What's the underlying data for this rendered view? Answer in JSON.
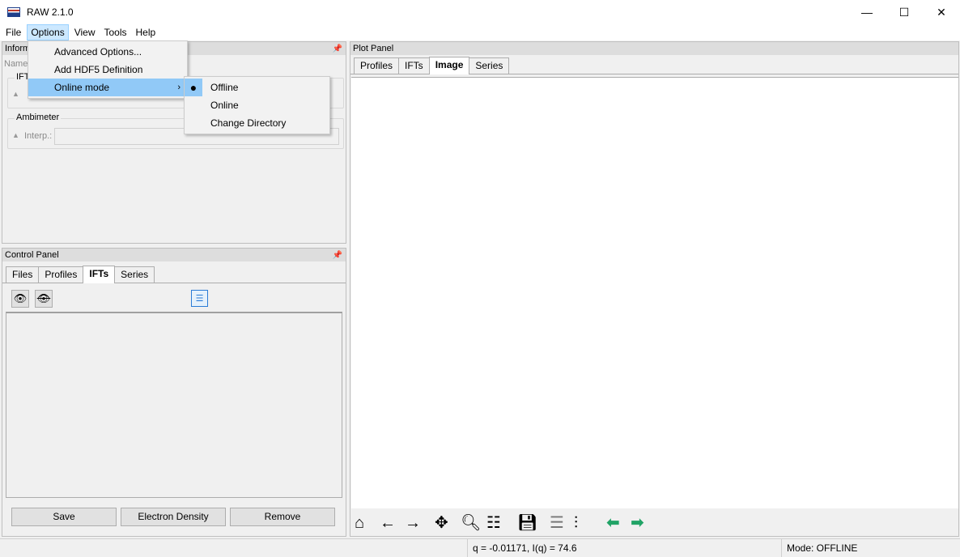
{
  "window": {
    "title": "RAW 2.1.0",
    "controls": [
      "—",
      "☐",
      "✕"
    ]
  },
  "menubar": {
    "file": "File",
    "options": "Options",
    "view": "View",
    "tools": "Tools",
    "help": "Help"
  },
  "options_menu": {
    "items": [
      "Advanced Options...",
      "Add HDF5 Definition",
      "Online mode"
    ],
    "submenu_arrow": "›"
  },
  "online_submenu": {
    "items": [
      "Offline",
      "Online",
      "Change Directory"
    ],
    "selected_marker": "●"
  },
  "info_panel": {
    "title": "Inform",
    "name_label": "Name:",
    "ift_group": "IFT",
    "ambimeter_group": "Ambimeter",
    "interp_label": "Interp.:"
  },
  "control_panel": {
    "title": "Control Panel",
    "tabs": [
      "Files",
      "Profiles",
      "IFTs",
      "Series"
    ],
    "active_tab": "IFTs",
    "buttons": {
      "save": "Save",
      "electron_density": "Electron Density",
      "remove": "Remove"
    }
  },
  "plot_panel": {
    "title": "Plot Panel",
    "tabs": [
      "Profiles",
      "IFTs",
      "Image",
      "Series"
    ],
    "active_tab": "Image",
    "toolbar_icons": [
      "home-icon",
      "back-arrow-icon",
      "forward-arrow-icon",
      "pan-icon",
      "zoom-icon",
      "configure-subplots-icon",
      "save-icon",
      "list-icon",
      "sliders-icon",
      "green-left-arrow-icon",
      "green-right-arrow-icon"
    ]
  },
  "status": {
    "coords": "q = -0.01171, I(q) = 74.6",
    "mode": "Mode: OFFLINE"
  },
  "colors": {
    "accent": "#91c9f7",
    "menu_open": "#cce8ff",
    "green_arrow": "#21a366"
  }
}
